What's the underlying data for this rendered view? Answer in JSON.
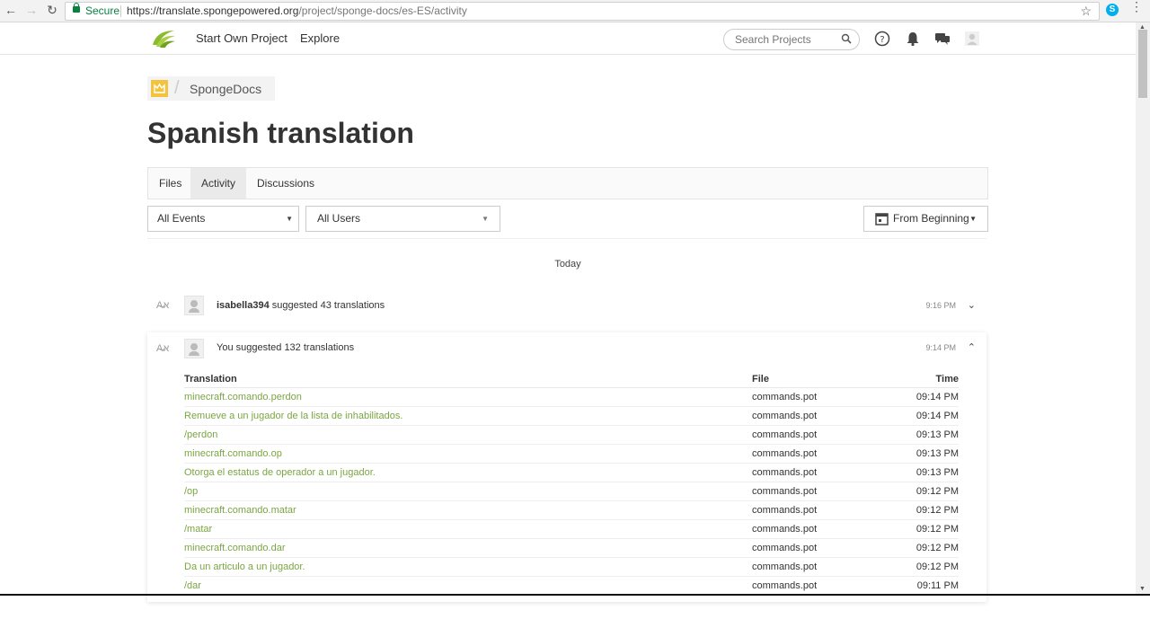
{
  "browser": {
    "secure_label": "Secure",
    "url_host": "https://translate.spongepowered.org",
    "url_path": "/project/sponge-docs/es-ES/activity",
    "back_icon": "arrow-left-icon",
    "forward_icon": "arrow-right-icon",
    "reload_icon": "reload-icon"
  },
  "topnav": {
    "start_project": "Start Own Project",
    "explore": "Explore",
    "search_placeholder": "Search Projects"
  },
  "project": {
    "name": "SpongeDocs",
    "title": "Spanish translation"
  },
  "tabs": [
    "Files",
    "Activity",
    "Discussions"
  ],
  "filters": {
    "events": "All Events",
    "users": "All Users",
    "date": "From Beginning"
  },
  "day_label": "Today",
  "events": [
    {
      "user": "isabella394",
      "action": "suggested 43 translations",
      "time": "9:16 PM"
    },
    {
      "user": "You",
      "action": "suggested 132 translations",
      "time": "9:14 PM"
    }
  ],
  "table": {
    "headers": {
      "translation": "Translation",
      "file": "File",
      "time": "Time"
    },
    "rows": [
      {
        "translation": "minecraft.comando.perdon",
        "file": "commands.pot",
        "time": "09:14 PM"
      },
      {
        "translation": "Remueve a un jugador de la lista de inhabilitados.",
        "file": "commands.pot",
        "time": "09:14 PM"
      },
      {
        "translation": "/perdon",
        "file": "commands.pot",
        "time": "09:13 PM"
      },
      {
        "translation": "minecraft.comando.op",
        "file": "commands.pot",
        "time": "09:13 PM"
      },
      {
        "translation": "Otorga el estatus de operador a un jugador.",
        "file": "commands.pot",
        "time": "09:13 PM"
      },
      {
        "translation": "/op",
        "file": "commands.pot",
        "time": "09:12 PM"
      },
      {
        "translation": "minecraft.comando.matar",
        "file": "commands.pot",
        "time": "09:12 PM"
      },
      {
        "translation": "/matar",
        "file": "commands.pot",
        "time": "09:12 PM"
      },
      {
        "translation": "minecraft.comando.dar",
        "file": "commands.pot",
        "time": "09:12 PM"
      },
      {
        "translation": "Da un articulo a un jugador.",
        "file": "commands.pot",
        "time": "09:12 PM"
      },
      {
        "translation": "/dar",
        "file": "commands.pot",
        "time": "09:11 PM"
      }
    ]
  },
  "colors": {
    "link_green": "#7aa642",
    "secure_green": "#0b8043",
    "project_avatar": "#f3c33d"
  }
}
